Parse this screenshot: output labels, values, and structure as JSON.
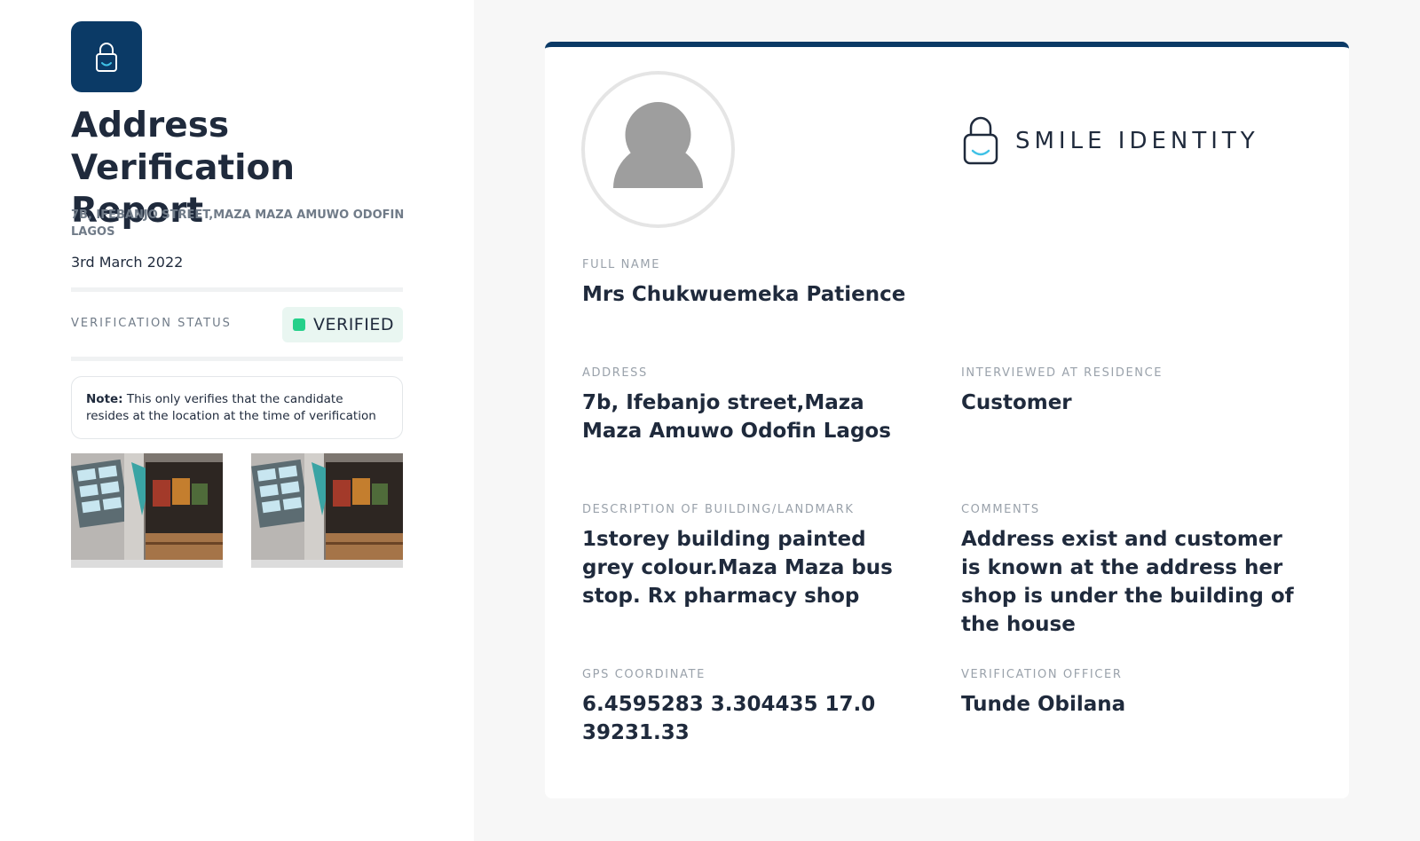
{
  "sidebar": {
    "logo_icon": "lock-smile-icon",
    "title": "Address Verification Report",
    "address": "7B, IFEBANJO STREET,MAZA MAZA AMUWO ODOFIN LAGOS",
    "date": "3rd March 2022",
    "status_label": "VERIFICATION STATUS",
    "status_value": "VERIFIED",
    "status_color": "#25d08a",
    "note_bold": "Note:",
    "note_text": "This only verifies that the candidate resides at the location at the time of verification",
    "photos": [
      "residence-photo",
      "residence-photo"
    ]
  },
  "brand": {
    "name": "SMILE IDENTITY",
    "accent_color": "#0b3a66"
  },
  "fields": {
    "full_name": {
      "label": "FULL NAME",
      "value": "Mrs Chukwuemeka Patience"
    },
    "address": {
      "label": "ADDRESS",
      "value": "7b, Ifebanjo street,Maza Maza Amuwo Odofin Lagos"
    },
    "interviewed": {
      "label": "INTERVIEWED AT RESIDENCE",
      "value": "Customer"
    },
    "description": {
      "label": "DESCRIPTION OF BUILDING/LANDMARK",
      "value": "1storey building painted grey colour.Maza Maza bus stop. Rx pharmacy shop"
    },
    "comments": {
      "label": "COMMENTS",
      "value": "Address exist and customer is known at the address her shop is under the building of the house"
    },
    "gps": {
      "label": "GPS COORDINATE",
      "value": "6.4595283 3.304435 17.0 39231.33"
    },
    "officer": {
      "label": "VERIFICATION OFFICER",
      "value": "Tunde Obilana"
    }
  }
}
